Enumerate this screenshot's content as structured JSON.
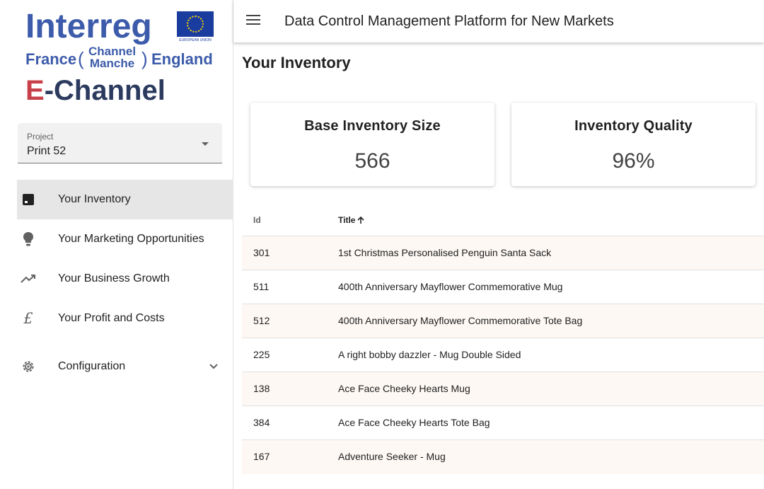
{
  "logo": {
    "interreg": "Interreg",
    "eu_label": "EUROPEAN UNION",
    "france": "France",
    "paren_open": "(",
    "channel": "Channel",
    "manche": "Manche",
    "paren_close": ")",
    "england": "England",
    "e": "E",
    "echannel": "-Channel"
  },
  "project": {
    "label": "Project",
    "value": "Print 52"
  },
  "nav": {
    "items": [
      {
        "label": "Your Inventory",
        "icon": "inventory-icon",
        "active": true
      },
      {
        "label": "Your Marketing Opportunities",
        "icon": "lightbulb-icon"
      },
      {
        "label": "Your Business Growth",
        "icon": "trending-up-icon"
      },
      {
        "label": "Your Profit and Costs",
        "icon": "pound-icon",
        "glyph": "£"
      }
    ],
    "config": {
      "label": "Configuration",
      "icon": "gear-icon"
    }
  },
  "appbar": {
    "title": "Data Control Management Platform for New Markets"
  },
  "page": {
    "title": "Your Inventory"
  },
  "cards": [
    {
      "title": "Base Inventory Size",
      "value": "566"
    },
    {
      "title": "Inventory Quality",
      "value": "96%"
    }
  ],
  "table": {
    "headers": {
      "id": "Id",
      "title": "Title"
    },
    "rows": [
      {
        "id": "301",
        "title": "1st Christmas Personalised Penguin Santa Sack"
      },
      {
        "id": "511",
        "title": "400th Anniversary Mayflower Commemorative Mug"
      },
      {
        "id": "512",
        "title": "400th Anniversary Mayflower Commemorative Tote Bag"
      },
      {
        "id": "225",
        "title": "A right bobby dazzler - Mug Double Sided"
      },
      {
        "id": "138",
        "title": "Ace Face Cheeky Hearts Mug"
      },
      {
        "id": "384",
        "title": "Ace Face Cheeky Hearts Tote Bag"
      },
      {
        "id": "167",
        "title": "Adventure Seeker - Mug"
      }
    ]
  },
  "colors": {
    "interreg_blue": "#3c5baa",
    "echannel_red": "#c8414a",
    "echannel_navy": "#2b3a5e",
    "active_nav_bg": "#e6e6e6",
    "row_alt_bg": "#fdf8f4"
  }
}
